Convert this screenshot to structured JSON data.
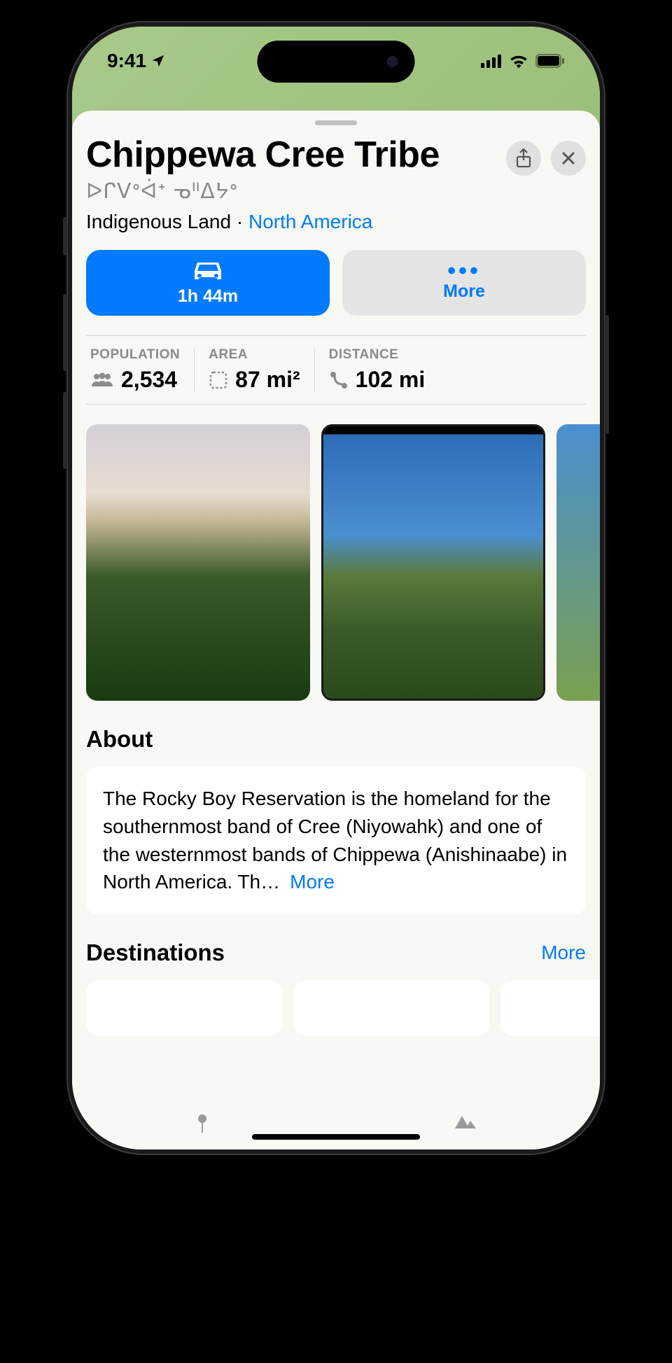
{
  "status": {
    "time": "9:41"
  },
  "place": {
    "title": "Chippewa Cree Tribe",
    "native_name": "ᐅᒋᐯᐤᐋᕀ ᓀᐦᐃᔭᐤ",
    "category": "Indigenous Land",
    "region": "North America"
  },
  "actions": {
    "drive_duration": "1h 44m",
    "more_label": "More"
  },
  "stats": {
    "population": {
      "label": "POPULATION",
      "value": "2,534"
    },
    "area": {
      "label": "AREA",
      "value": "87 mi²"
    },
    "distance": {
      "label": "DISTANCE",
      "value": "102 mi"
    }
  },
  "about": {
    "heading": "About",
    "text": "The Rocky Boy Reservation is the homeland for the southernmost band of Cree (Niyowahk) and one of the westernmost bands of Chippewa (Anishinaabe) in North America. Th…",
    "more": "More"
  },
  "destinations": {
    "heading": "Destinations",
    "more": "More"
  }
}
